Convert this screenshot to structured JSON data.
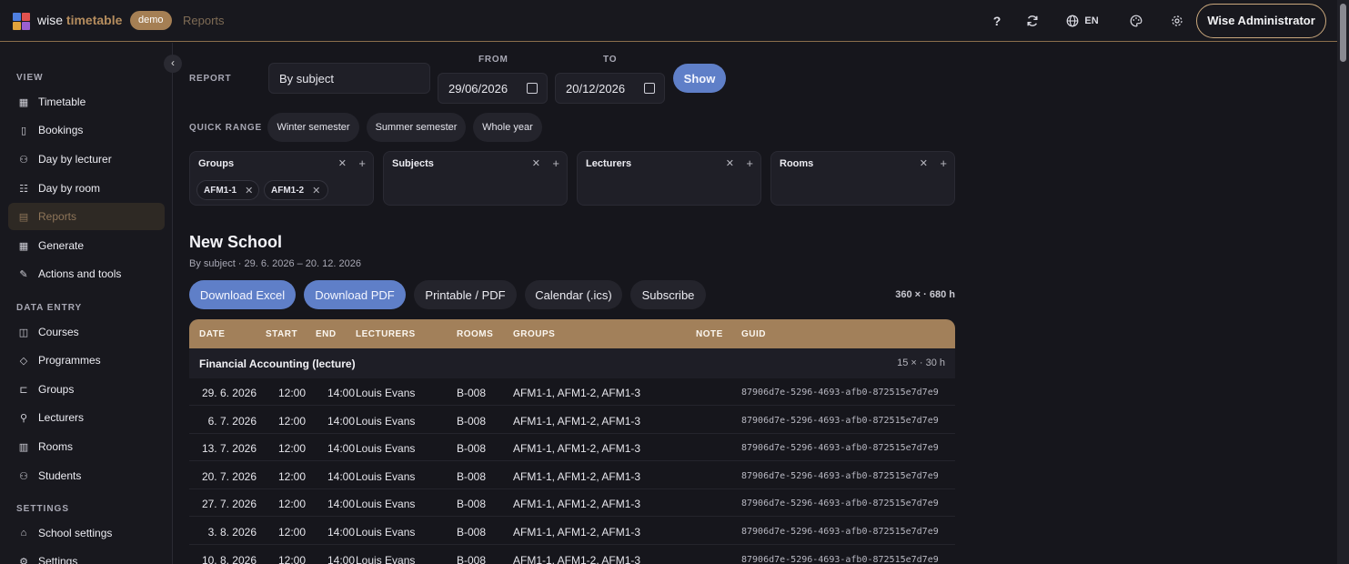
{
  "header": {
    "brand_word": "wise",
    "brand_accent": "timetable",
    "badge": "demo",
    "breadcrumb": "Reports",
    "help": "?",
    "language": "EN",
    "user": "Wise Administrator",
    "colors": {
      "accent": "#b58d5e",
      "blue": "#5f7fc8"
    }
  },
  "sidebar": {
    "sections": [
      {
        "title": "VIEW",
        "items": [
          {
            "label": "Timetable",
            "icon": "table-icon"
          },
          {
            "label": "Bookings",
            "icon": "bookmark-icon"
          },
          {
            "label": "Day by lecturer",
            "icon": "people-list-icon"
          },
          {
            "label": "Day by room",
            "icon": "room-list-icon"
          },
          {
            "label": "Reports",
            "icon": "report-icon",
            "active": true
          },
          {
            "label": "Generate",
            "icon": "grid-icon"
          },
          {
            "label": "Actions and tools",
            "icon": "wrench-icon"
          }
        ]
      },
      {
        "title": "DATA ENTRY",
        "items": [
          {
            "label": "Courses",
            "icon": "book-icon"
          },
          {
            "label": "Programmes",
            "icon": "graduation-cap-icon"
          },
          {
            "label": "Groups",
            "icon": "groups-icon"
          },
          {
            "label": "Lecturers",
            "icon": "person-icon"
          },
          {
            "label": "Rooms",
            "icon": "building-icon"
          },
          {
            "label": "Students",
            "icon": "students-icon"
          }
        ]
      },
      {
        "title": "SETTINGS",
        "items": [
          {
            "label": "School settings",
            "icon": "school-icon"
          },
          {
            "label": "Settings",
            "icon": "gear-icon"
          }
        ]
      }
    ]
  },
  "report": {
    "report_label": "REPORT",
    "report_value": "By subject",
    "from_label": "FROM",
    "from_value": "29/06/2026",
    "to_label": "TO",
    "to_value": "20/12/2026",
    "show_label": "Show",
    "quick_range_label": "QUICK RANGE",
    "quick_ranges": [
      "Winter semester",
      "Summer semester",
      "Whole year"
    ]
  },
  "filters": [
    {
      "title": "Groups",
      "chips": [
        "AFM1-1",
        "AFM1-2"
      ]
    },
    {
      "title": "Subjects",
      "chips": []
    },
    {
      "title": "Lecturers",
      "chips": []
    },
    {
      "title": "Rooms",
      "chips": []
    }
  ],
  "result": {
    "title": "New School",
    "subtitle": "By subject  ·  29. 6. 2026 – 20. 12. 2026",
    "actions": [
      "Download Excel",
      "Download PDF",
      "Printable / PDF",
      "Calendar (.ics)",
      "Subscribe"
    ],
    "summary": "360 ×  ·  680 h"
  },
  "table": {
    "columns": [
      "DATE",
      "START",
      "END",
      "LECTURERS",
      "ROOMS",
      "GROUPS",
      "NOTE",
      "GUID"
    ],
    "group": {
      "name": "Financial Accounting (lecture)",
      "summary": "15 ×  ·  30 h"
    },
    "rows": [
      {
        "date": "29. 6. 2026",
        "start": "12:00",
        "end": "14:00",
        "lecturers": "Louis Evans",
        "rooms": "B-008",
        "groups": "AFM1-1, AFM1-2, AFM1-3",
        "note": "",
        "guid": "87906d7e-5296-4693-afb0-872515e7d7e9"
      },
      {
        "date": "6. 7. 2026",
        "start": "12:00",
        "end": "14:00",
        "lecturers": "Louis Evans",
        "rooms": "B-008",
        "groups": "AFM1-1, AFM1-2, AFM1-3",
        "note": "",
        "guid": "87906d7e-5296-4693-afb0-872515e7d7e9"
      },
      {
        "date": "13. 7. 2026",
        "start": "12:00",
        "end": "14:00",
        "lecturers": "Louis Evans",
        "rooms": "B-008",
        "groups": "AFM1-1, AFM1-2, AFM1-3",
        "note": "",
        "guid": "87906d7e-5296-4693-afb0-872515e7d7e9"
      },
      {
        "date": "20. 7. 2026",
        "start": "12:00",
        "end": "14:00",
        "lecturers": "Louis Evans",
        "rooms": "B-008",
        "groups": "AFM1-1, AFM1-2, AFM1-3",
        "note": "",
        "guid": "87906d7e-5296-4693-afb0-872515e7d7e9"
      },
      {
        "date": "27. 7. 2026",
        "start": "12:00",
        "end": "14:00",
        "lecturers": "Louis Evans",
        "rooms": "B-008",
        "groups": "AFM1-1, AFM1-2, AFM1-3",
        "note": "",
        "guid": "87906d7e-5296-4693-afb0-872515e7d7e9"
      },
      {
        "date": "3. 8. 2026",
        "start": "12:00",
        "end": "14:00",
        "lecturers": "Louis Evans",
        "rooms": "B-008",
        "groups": "AFM1-1, AFM1-2, AFM1-3",
        "note": "",
        "guid": "87906d7e-5296-4693-afb0-872515e7d7e9"
      },
      {
        "date": "10. 8. 2026",
        "start": "12:00",
        "end": "14:00",
        "lecturers": "Louis Evans",
        "rooms": "B-008",
        "groups": "AFM1-1, AFM1-2, AFM1-3",
        "note": "",
        "guid": "87906d7e-5296-4693-afb0-872515e7d7e9"
      }
    ]
  }
}
